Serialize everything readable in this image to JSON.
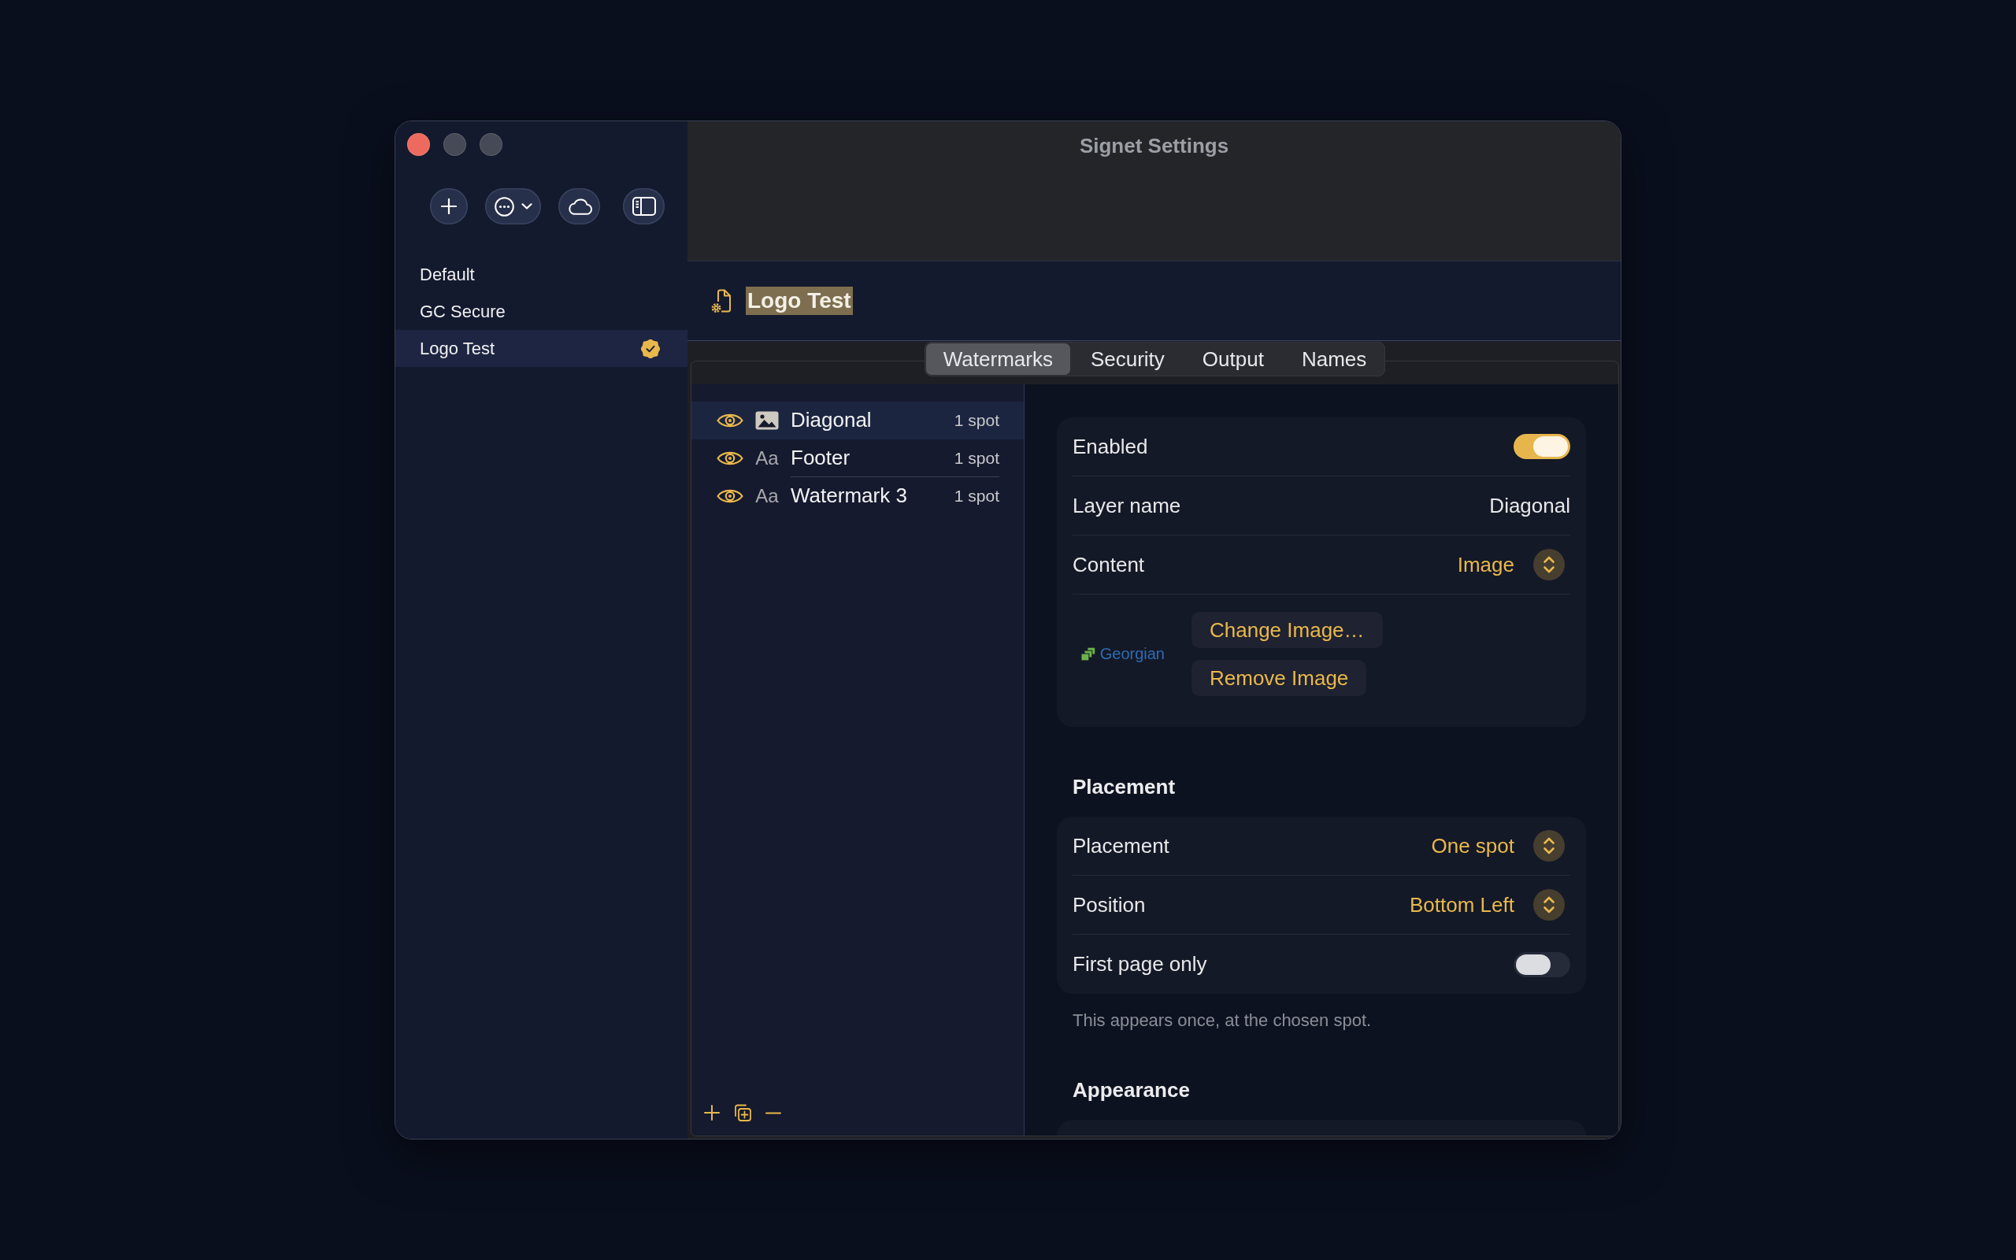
{
  "window": {
    "title": "Signet Settings",
    "controls": [
      {
        "kind": "close",
        "disabled": false
      },
      {
        "kind": "minimize",
        "disabled": true
      },
      {
        "kind": "zoom",
        "disabled": true
      }
    ]
  },
  "toolbar": [
    {
      "kind": "add"
    },
    {
      "kind": "more"
    },
    {
      "kind": "cloud"
    },
    {
      "kind": "sidebar"
    }
  ],
  "sidebar": {
    "items": [
      {
        "label": "Default",
        "selected": false,
        "active": false
      },
      {
        "label": "GC Secure",
        "selected": false,
        "active": false
      },
      {
        "label": "Logo Test",
        "selected": true,
        "active": true
      }
    ]
  },
  "header": {
    "title": "Logo Test",
    "highlighted": true
  },
  "tabs": [
    {
      "label": "Watermarks",
      "selected": true
    },
    {
      "label": "Security",
      "selected": false
    },
    {
      "label": "Output",
      "selected": false
    },
    {
      "label": "Names",
      "selected": false
    }
  ],
  "layers": {
    "items": [
      {
        "name": "Diagonal",
        "kind": "image",
        "visible": true,
        "count": "1 spot",
        "selected": true
      },
      {
        "name": "Footer",
        "kind": "text",
        "glyph": "Aa",
        "visible": true,
        "count": "1 spot",
        "selected": false
      },
      {
        "name": "Watermark 3",
        "kind": "text",
        "glyph": "Aa",
        "visible": true,
        "count": "1 spot",
        "selected": false
      }
    ],
    "actions": [
      {
        "kind": "add"
      },
      {
        "kind": "duplicate"
      },
      {
        "kind": "remove"
      }
    ]
  },
  "detail": {
    "general": [
      {
        "kind": "toggle",
        "label": "Enabled",
        "on": true
      },
      {
        "kind": "text",
        "label": "Layer name",
        "value": "Diagonal"
      },
      {
        "kind": "select",
        "label": "Content",
        "value": "Image"
      }
    ],
    "image": {
      "logo_text": "Georgian",
      "buttons": [
        "Change Image…",
        "Remove Image"
      ]
    },
    "sections": [
      {
        "heading": "Placement",
        "rows": [
          {
            "kind": "select",
            "label": "Placement",
            "value": "One spot"
          },
          {
            "kind": "select",
            "label": "Position",
            "value": "Bottom Left"
          },
          {
            "kind": "toggle",
            "label": "First page only",
            "on": false
          }
        ],
        "note": "This appears once, at the chosen spot."
      },
      {
        "heading": "Appearance"
      }
    ]
  }
}
